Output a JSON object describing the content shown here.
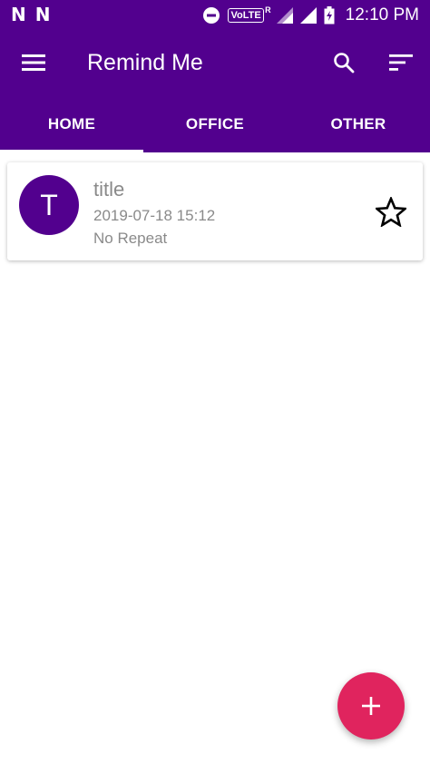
{
  "status_bar": {
    "left_icons": [
      "N",
      "N"
    ],
    "volte": "VoLTE",
    "volte_sup": "R",
    "time": "12:10 PM"
  },
  "app_bar": {
    "title": "Remind Me",
    "icons": [
      "menu-icon",
      "search-icon",
      "sort-icon"
    ]
  },
  "tabs": [
    {
      "label": "HOME",
      "active": true
    },
    {
      "label": "OFFICE",
      "active": false
    },
    {
      "label": "OTHER",
      "active": false
    }
  ],
  "reminders": [
    {
      "avatar_letter": "T",
      "title": "title",
      "datetime": "2019-07-18 15:12",
      "repeat": "No Repeat",
      "starred": false
    }
  ],
  "fab": {
    "icon": "plus-icon"
  },
  "colors": {
    "primary": "#52008e",
    "accent": "#e0245e",
    "secondary_text": "#8a8a8a"
  }
}
